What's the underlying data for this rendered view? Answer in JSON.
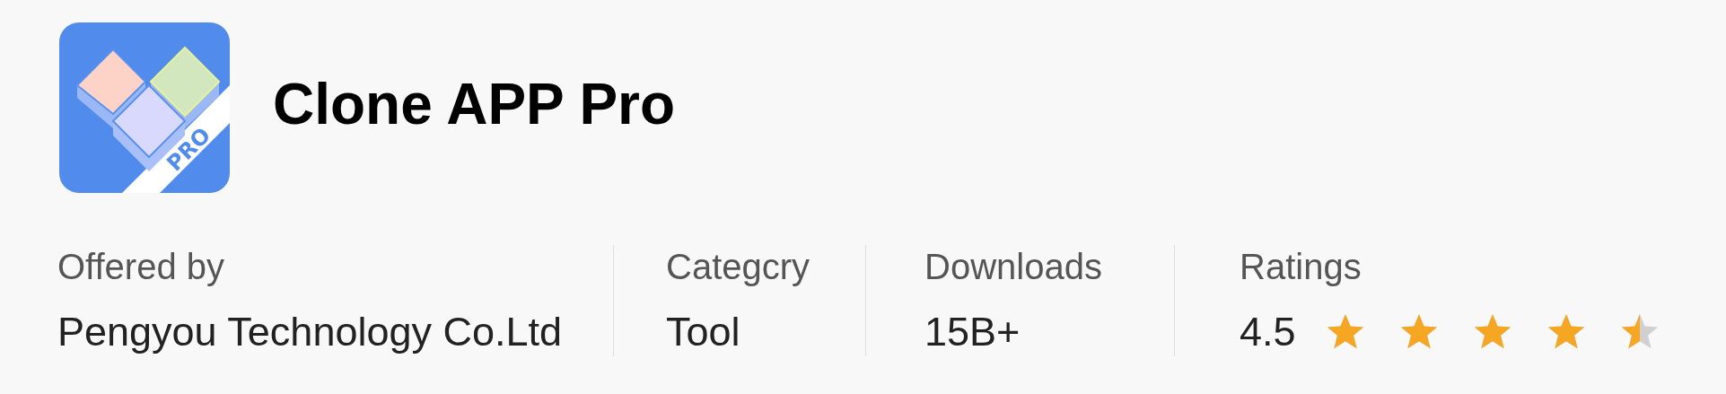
{
  "app": {
    "name": "Clone APP Pro",
    "icon_badge": "PRO"
  },
  "stats": [
    {
      "kind": "text",
      "label": "Offered by",
      "value": "Pengyou Technology Co.Ltd"
    },
    {
      "kind": "text",
      "label": "Categcry",
      "value": "Tool"
    },
    {
      "kind": "text",
      "label": "Downloads",
      "value": "15B+"
    },
    {
      "kind": "rating",
      "label": "Ratings",
      "value": "4.5",
      "stars": 4.5
    }
  ]
}
